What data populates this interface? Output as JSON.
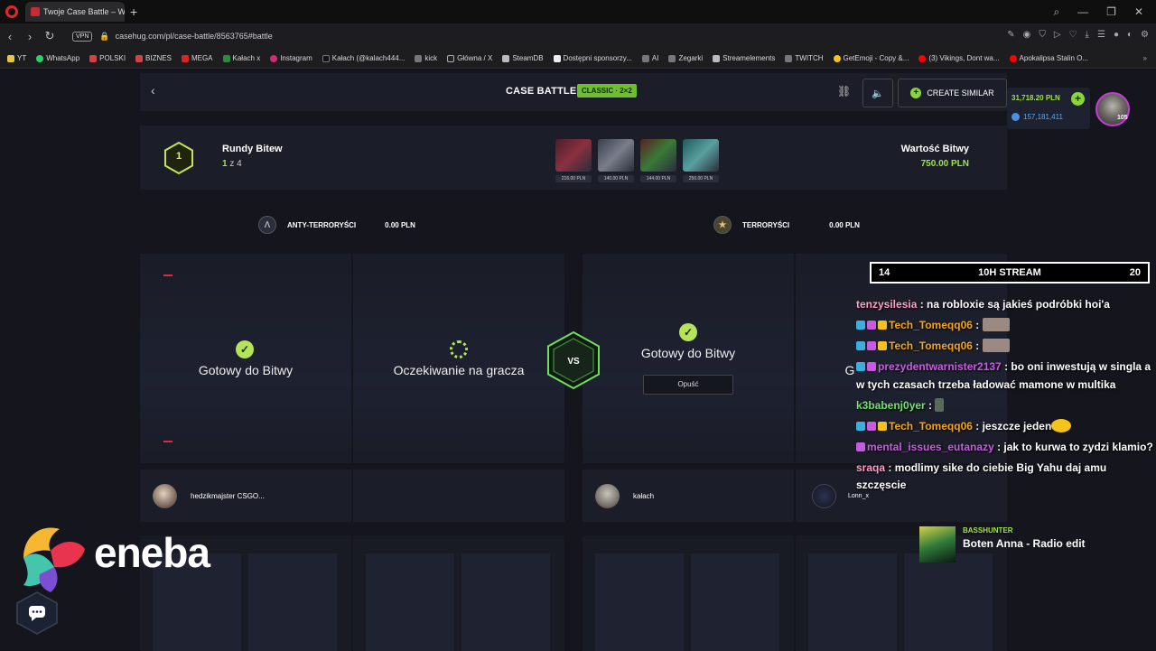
{
  "browser": {
    "tab_title": "Twoje Case Battle – Wygr",
    "url": "casehug.com/pl/case-battle/8563765#battle",
    "vpn_label": "VPN",
    "bookmarks": [
      "YT",
      "WhatsApp",
      "POLSKI",
      "BIZNES",
      "MEGA",
      "Kałach x",
      "Instagram",
      "Kałach (@kalach444...",
      "kick",
      "Główna / X",
      "SteamDB",
      "Dostępni sponsorzy...",
      "AI",
      "Zegarki",
      "Streamelements",
      "TWITCH",
      "GetEmoji - Copy &...",
      "(3) Vikings, Dont wa...",
      "Apokalipsa Stalin O..."
    ]
  },
  "header": {
    "title": "CASE BATTLE",
    "mode": "CLASSIC · 2×2",
    "create_similar": "CREATE SIMILAR"
  },
  "wallet": {
    "balance": "31,718.20 PLN",
    "coins": "157,181,411",
    "level": "105"
  },
  "rounds": {
    "current_round": "1",
    "title": "Rundy Bitew",
    "current": "1",
    "of_total": " z 4",
    "cases": [
      "216.00 PLN",
      "140.00 PLN",
      "144.00 PLN",
      "250.00 PLN"
    ],
    "value_title": "Wartość Bitwy",
    "value_amount": "750.00 PLN"
  },
  "teams": {
    "ct_name": "ANTY-TERRORYŚCI",
    "ct_amount": "0.00 PLN",
    "t_name": "TERRORYŚCI",
    "t_amount": "0.00 PLN"
  },
  "slots": {
    "s1_status": "Gotowy do Bitwy",
    "s2_status": "Oczekiwanie na gracza",
    "s3_status": "Gotowy do Bitwy",
    "s4_status": "G",
    "leave": "Opuść",
    "vs": "VS"
  },
  "players": {
    "p1": "hedzikmajster CSGO...",
    "p3": "kałach",
    "p4": "Lonn_x"
  },
  "stream": {
    "left_num": "14",
    "label": "10H STREAM",
    "right_num": "20"
  },
  "chat": [
    {
      "user": "tenzysilesia",
      "text": " : na robloxie są jakieś podróbki hoi'a"
    },
    {
      "user": "Tech_Tomeqq06",
      "text": " : "
    },
    {
      "user": "Tech_Tomeqq06",
      "text": " : "
    },
    {
      "user": "prezydentwarnister2137",
      "text": " : bo oni inwestują w singla a w tych czasach trzeba ładować mamone w multika"
    },
    {
      "user": "k3babenj0yer",
      "text": " : "
    },
    {
      "user": "Tech_Tomeqq06",
      "text": " : jeszcze jeden"
    },
    {
      "user": "mental_issues_eutanazy",
      "text": " : jak to kurwa to zydzi klamio?"
    },
    {
      "user": "sraqa",
      "text": " : modlimy sike do ciebie Big Yahu daj amu szczęscie"
    }
  ],
  "now_playing": {
    "artist": "BASSHUNTER",
    "track": "Boten Anna - Radio edit"
  },
  "sponsor": {
    "name": "eneba"
  }
}
